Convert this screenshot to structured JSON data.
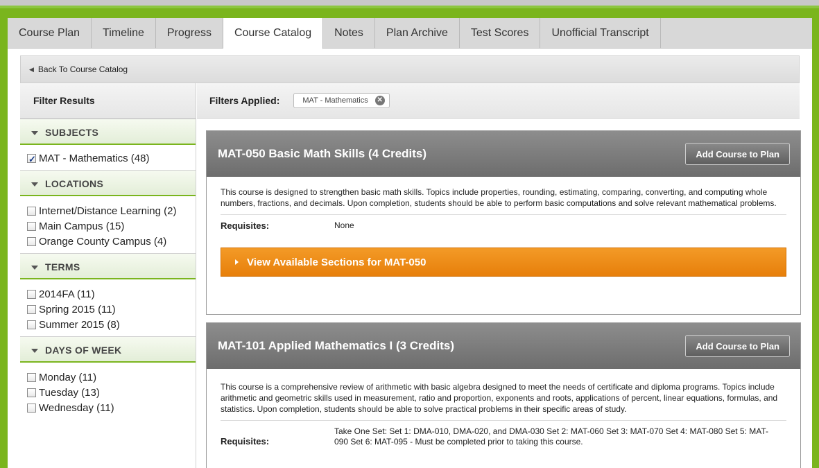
{
  "tabs": [
    {
      "label": "Course Plan",
      "active": false
    },
    {
      "label": "Timeline",
      "active": false
    },
    {
      "label": "Progress",
      "active": false
    },
    {
      "label": "Course Catalog",
      "active": true
    },
    {
      "label": "Notes",
      "active": false
    },
    {
      "label": "Plan Archive",
      "active": false
    },
    {
      "label": "Test Scores",
      "active": false
    },
    {
      "label": "Unofficial Transcript",
      "active": false
    }
  ],
  "back_link": "Back To Course Catalog",
  "filter_results_label": "Filter Results",
  "filters_applied_label": "Filters Applied:",
  "applied_filter_chip": "MAT - Mathematics",
  "filters": {
    "subjects": {
      "title": "SUBJECTS",
      "options": [
        {
          "label": "MAT - Mathematics (48)",
          "checked": true
        }
      ]
    },
    "locations": {
      "title": "LOCATIONS",
      "options": [
        {
          "label": "Internet/Distance Learning (2)",
          "checked": false
        },
        {
          "label": "Main Campus (15)",
          "checked": false
        },
        {
          "label": "Orange County Campus (4)",
          "checked": false
        }
      ]
    },
    "terms": {
      "title": "TERMS",
      "options": [
        {
          "label": "2014FA (11)",
          "checked": false
        },
        {
          "label": "Spring 2015 (11)",
          "checked": false
        },
        {
          "label": "Summer 2015 (8)",
          "checked": false
        }
      ]
    },
    "days": {
      "title": "DAYS OF WEEK",
      "options": [
        {
          "label": "Monday (11)",
          "checked": false
        },
        {
          "label": "Tuesday (13)",
          "checked": false
        },
        {
          "label": "Wednesday (11)",
          "checked": false
        }
      ]
    }
  },
  "courses": [
    {
      "title": "MAT-050 Basic Math Skills (4 Credits)",
      "add_label": "Add Course to Plan",
      "description": "This course is designed to strengthen basic math skills. Topics include properties, rounding, estimating, comparing, converting, and computing whole numbers, fractions, and decimals. Upon completion, students should be able to perform basic computations and solve relevant mathematical problems.",
      "requisites_label": "Requisites:",
      "requisites": "None",
      "sections_label": "View Available Sections for MAT-050"
    },
    {
      "title": "MAT-101 Applied Mathematics I (3 Credits)",
      "add_label": "Add Course to Plan",
      "description": "This course is a comprehensive review of arithmetic with basic algebra designed to meet the needs of certificate and diploma programs. Topics include arithmetic and geometric skills used in measurement, ratio and proportion, exponents and roots, applications of percent, linear equations, formulas, and statistics. Upon completion, students should be able to solve practical problems in their specific areas of study.",
      "requisites_label": "Requisites:",
      "requisites": "Take One Set: Set 1: DMA-010, DMA-020, and DMA-030 Set 2: MAT-060 Set 3: MAT-070 Set 4: MAT-080 Set 5: MAT-090 Set 6: MAT-095 - Must be completed prior to taking this course."
    }
  ],
  "colors": {
    "frame_green": "#7ab51d",
    "orange": "#e8820c",
    "header_gray": "#7a7a7a"
  }
}
